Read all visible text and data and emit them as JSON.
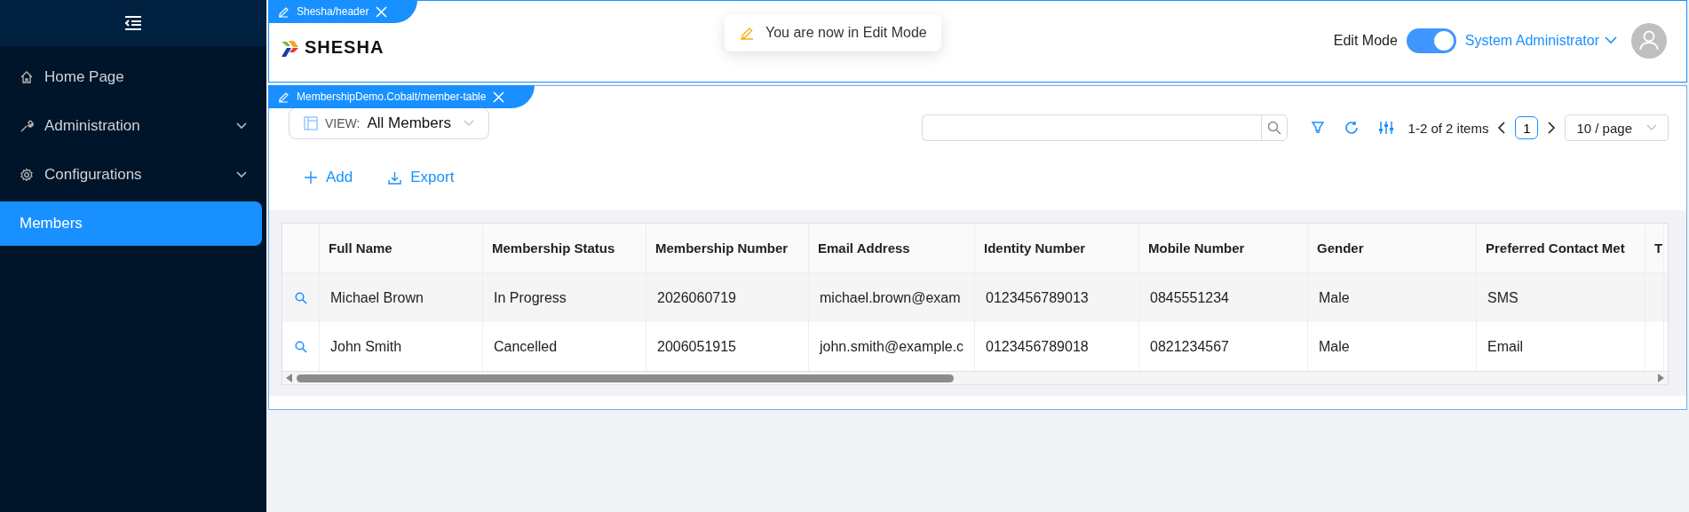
{
  "sidebar": {
    "items": [
      {
        "label": "Home Page",
        "expandable": false,
        "selected": false
      },
      {
        "label": "Administration",
        "expandable": true,
        "selected": false
      },
      {
        "label": "Configurations",
        "expandable": true,
        "selected": false
      },
      {
        "label": "Members",
        "expandable": false,
        "selected": true
      }
    ]
  },
  "header": {
    "tag": "Shesha/header",
    "logo": "SHESHA",
    "toast": "You are now in Edit Mode",
    "edit_mode": {
      "label": "Edit Mode",
      "on": true
    },
    "user": "System Administrator"
  },
  "panel": {
    "tag": "MembershipDemo.Cobalt/member-table",
    "view": {
      "label": "VIEW:",
      "value": "All Members"
    },
    "pagination": {
      "summary": "1-2 of 2 items",
      "page": "1",
      "page_size": "10 / page"
    },
    "actions": [
      {
        "label": "Add",
        "kind": "add"
      },
      {
        "label": "Export",
        "kind": "export"
      }
    ],
    "table": {
      "columns": [
        "Full Name",
        "Membership Status",
        "Membership Number",
        "Email Address",
        "Identity Number",
        "Mobile Number",
        "Gender",
        "Preferred Contact Met",
        "T"
      ],
      "rows": [
        {
          "cells": [
            "Michael Brown",
            "In Progress",
            "2026060719",
            "michael.brown@exam",
            "0123456789013",
            "0845551234",
            "Male",
            "SMS",
            ""
          ]
        },
        {
          "cells": [
            "John Smith",
            "Cancelled",
            "2006051915",
            "john.smith@example.c",
            "0123456789018",
            "0821234567",
            "Male",
            "Email",
            ""
          ]
        }
      ]
    }
  }
}
